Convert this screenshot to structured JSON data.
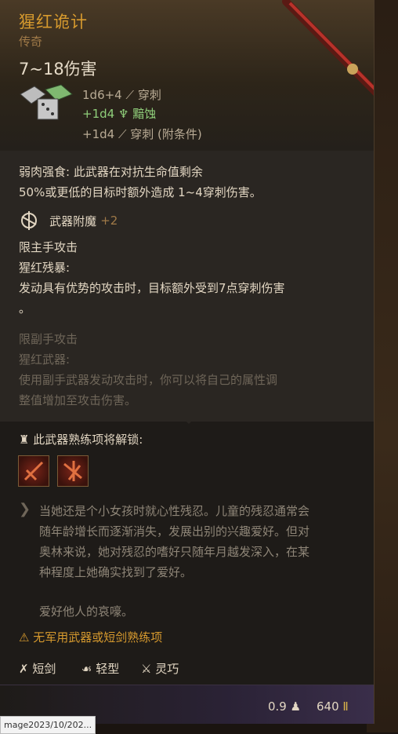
{
  "item": {
    "name": "猩红诡计",
    "rarity": "传奇",
    "damage": "7~18伤害",
    "damage_rows": [
      {
        "dice": "1d6+4",
        "type": "穿刺"
      },
      {
        "dice": "+1d4",
        "type": "黯蚀"
      },
      {
        "dice": "+1d4",
        "type": "穿刺 (附条件)"
      }
    ]
  },
  "passive": {
    "line1": "弱肉强食: 此武器在对抗生命值剩余",
    "line2": "50%或更低的目标时额外造成 1~4穿刺伤害。"
  },
  "enchant": {
    "label": "武器附魔",
    "value": "+2"
  },
  "main_hand": {
    "restriction": "限主手攻击",
    "ability_name": "猩红残暴:",
    "desc1": "发动具有优势的攻击时，目标额外受到7点穿刺伤害",
    "desc2": "。"
  },
  "off_hand": {
    "restriction": "限副手攻击",
    "ability_name": "猩红武器:",
    "desc1": "使用副手武器发动攻击时，你可以将自己的属性调",
    "desc2": "整值增加至攻击伤害。"
  },
  "proficiency": {
    "title": "此武器熟练项将解锁:"
  },
  "lore": {
    "lines": [
      "当她还是个小女孩时就心性残忍。儿童的残忍通常会",
      "随年龄增长而逐渐消失，发展出别的兴趣爱好。但对",
      "奥林来说，她对残忍的嗜好只随年月越发深入，在某",
      "种程度上她确实找到了爱好。",
      "",
      "爱好他人的哀嚎。"
    ]
  },
  "warning": "无军用武器或短剑熟练项",
  "traits": [
    {
      "label": "短剑",
      "icon": "short-sword-icon"
    },
    {
      "label": "轻型",
      "icon": "feather-icon"
    },
    {
      "label": "灵巧",
      "icon": "finesse-icon"
    }
  ],
  "footer": {
    "weight": "0.9",
    "price": "640"
  },
  "image_tag": "mage2023/10/202...",
  "colors": {
    "title": "#d79a2e",
    "rare_green": "#8fce7a",
    "panel": "#1e1b18",
    "section": "#2a2622"
  }
}
